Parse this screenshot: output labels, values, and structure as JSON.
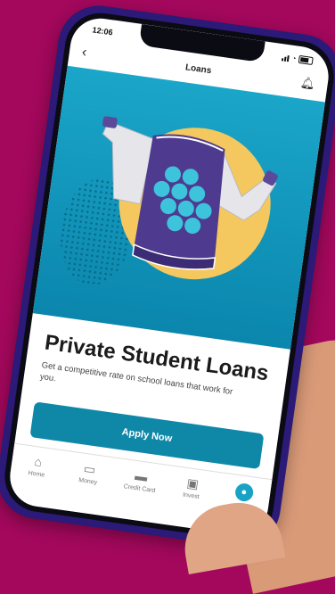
{
  "status": {
    "time": "12:06"
  },
  "nav": {
    "title": "Loans"
  },
  "hero": {
    "jacket_color": "#4e3a8f",
    "circle_color": "#f4c85e",
    "bg_color": "#129bc2"
  },
  "card": {
    "title": "Private Student Loans",
    "subtitle": "Get a competitive rate on school loans that work for you."
  },
  "apply_label": "Apply Now",
  "tabs": [
    {
      "label": "Home",
      "icon": "home-icon"
    },
    {
      "label": "Money",
      "icon": "money-icon"
    },
    {
      "label": "Credit Card",
      "icon": "credit-card-icon"
    },
    {
      "label": "Invest",
      "icon": "invest-icon"
    },
    {
      "label": "",
      "icon": "loans-icon"
    }
  ]
}
